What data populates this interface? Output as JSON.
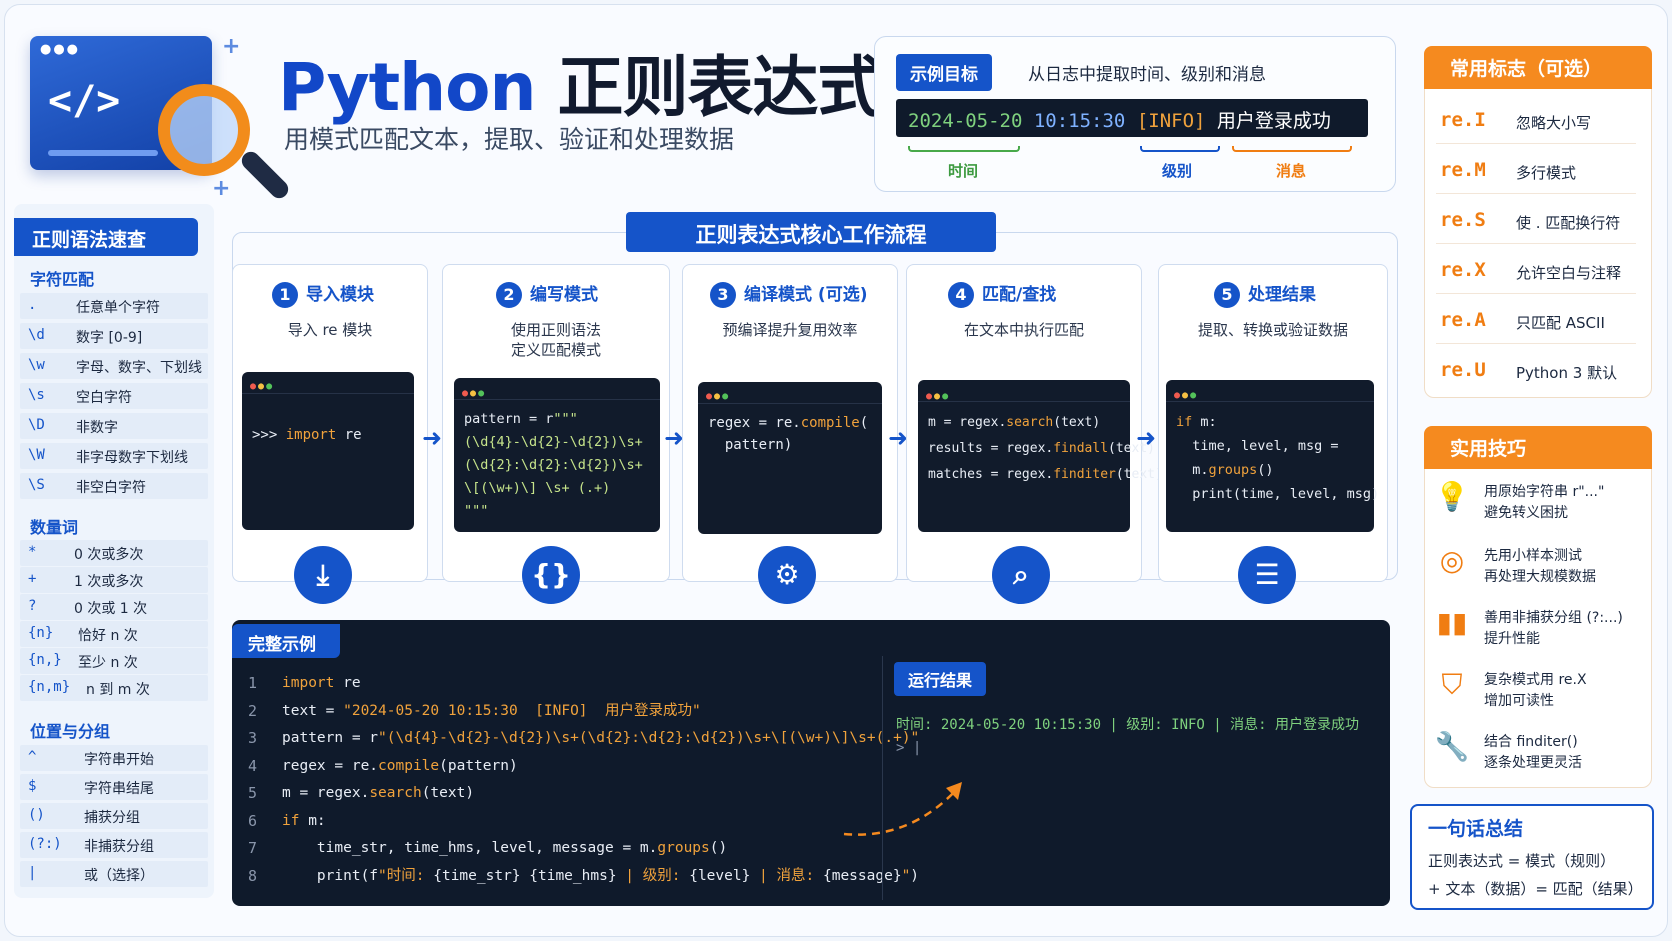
{
  "header": {
    "code_symbol": "</>",
    "title_en": "Python",
    "title_cn": "正则表达式",
    "subtitle": "用模式匹配文本，提取、验证和处理数据"
  },
  "example_target": {
    "tag": "示例目标",
    "desc": "从日志中提取时间、级别和消息",
    "log": {
      "date": "2024-05-20",
      "time": "10:15:30",
      "level": "[INFO]",
      "msg": "用户登录成功"
    },
    "labels": {
      "time": "时间",
      "level": "级别",
      "msg": "消息"
    }
  },
  "cheatsheet": {
    "title": "正则语法速查",
    "sections": [
      {
        "name": "字符匹配",
        "rows": [
          {
            "k": ".",
            "v": "任意单个字符"
          },
          {
            "k": "\\d",
            "v": "数字 [0-9]"
          },
          {
            "k": "\\w",
            "v": "字母、数字、下划线"
          },
          {
            "k": "\\s",
            "v": "空白字符"
          },
          {
            "k": "\\D",
            "v": "非数字"
          },
          {
            "k": "\\W",
            "v": "非字母数字下划线"
          },
          {
            "k": "\\S",
            "v": "非空白字符"
          }
        ]
      },
      {
        "name": "数量词",
        "rows": [
          {
            "k": "*",
            "v": "0 次或多次"
          },
          {
            "k": "+",
            "v": "1 次或多次"
          },
          {
            "k": "?",
            "v": "0 次或 1 次"
          },
          {
            "k": "{n}",
            "v": "恰好 n 次"
          },
          {
            "k": "{n,}",
            "v": "至少 n 次"
          },
          {
            "k": "{n,m}",
            "v": "n 到 m 次"
          }
        ]
      },
      {
        "name": "位置与分组",
        "rows": [
          {
            "k": "^",
            "v": "字符串开始"
          },
          {
            "k": "$",
            "v": "字符串结尾"
          },
          {
            "k": "()",
            "v": "捕获分组"
          },
          {
            "k": "(?:)",
            "v": "非捕获分组"
          },
          {
            "k": "|",
            "v": "或（选择）"
          }
        ]
      }
    ]
  },
  "workflow": {
    "title": "正则表达式核心工作流程",
    "steps": [
      {
        "num": "1",
        "title": "导入模块",
        "desc": "导入 re 模块",
        "icon": "download-icon"
      },
      {
        "num": "2",
        "title": "编写模式",
        "desc": "使用正则语法\n定义匹配模式",
        "icon": "braces-icon"
      },
      {
        "num": "3",
        "title": "编译模式 (可选)",
        "desc": "预编译提升复用效率",
        "icon": "gear-icon"
      },
      {
        "num": "4",
        "title": "匹配/查找",
        "desc": "在文本中执行匹配",
        "icon": "search-icon"
      },
      {
        "num": "5",
        "title": "处理结果",
        "desc": "提取、转换或验证数据",
        "icon": "document-icon"
      }
    ]
  },
  "full_example": {
    "tag": "完整示例",
    "line_numbers": [
      "1",
      "2",
      "3",
      "4",
      "5",
      "6",
      "7",
      "8"
    ],
    "result_tag": "运行结果",
    "result_output": "时间: 2024-05-20 10:15:30 | 级别: INFO | 消息: 用户登录成功",
    "prompt": "> |"
  },
  "flags": {
    "title": "常用标志（可选）",
    "items": [
      {
        "k": "re.I",
        "v": "忽略大小写"
      },
      {
        "k": "re.M",
        "v": "多行模式"
      },
      {
        "k": "re.S",
        "v": "使 . 匹配换行符"
      },
      {
        "k": "re.X",
        "v": "允许空白与注释"
      },
      {
        "k": "re.A",
        "v": "只匹配 ASCII"
      },
      {
        "k": "re.U",
        "v": "Python 3 默认"
      }
    ]
  },
  "tips": {
    "title": "实用技巧",
    "items": [
      {
        "icon": "lightbulb-icon",
        "l1": "用原始字符串 r\"...\"",
        "l2": "避免转义困扰"
      },
      {
        "icon": "target-icon",
        "l1": "先用小样本测试",
        "l2": "再处理大规模数据"
      },
      {
        "icon": "bar-chart-icon",
        "l1": "善用非捕获分组 (?:...)",
        "l2": "提升性能"
      },
      {
        "icon": "shield-icon",
        "l1": "复杂模式用 re.X",
        "l2": "增加可读性"
      },
      {
        "icon": "wrench-icon",
        "l1": "结合 finditer()",
        "l2": "逐条处理更灵活"
      }
    ]
  },
  "summary": {
    "title": "一句话总结",
    "l1": "正则表达式 = 模式（规则）",
    "l2": "+ 文本（数据）= 匹配（结果）"
  },
  "colors": {
    "primary": "#1554c9",
    "accent": "#f58a1f",
    "dark": "#0f1a2b",
    "green": "#7fd17e"
  }
}
